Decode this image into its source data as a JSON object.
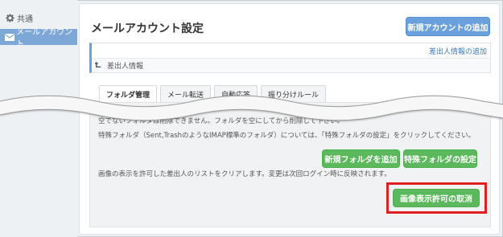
{
  "sidebar": {
    "items": [
      {
        "label": "共通",
        "icon": "gear-icon"
      },
      {
        "label": "メールアカウント",
        "icon": "envelope-icon",
        "active": true
      }
    ]
  },
  "main": {
    "title": "メールアカウント設定",
    "add_account_button": "新規アカウントの追加",
    "sender": {
      "add_link": "差出人情報の追加",
      "row_label": "差出人情報"
    },
    "tabs": [
      {
        "label": "フォルダ管理",
        "active": true
      },
      {
        "label": "メール転送"
      },
      {
        "label": "自動応答"
      },
      {
        "label": "振り分けルール"
      }
    ],
    "content": {
      "line1": "空でないフォルダは削除できません。フォルダを空にしてから削除して下さい。",
      "line2": "特殊フォルダ（Sent,TrashのようなIMAP標準のフォルダ）については、「特殊フォルダの設定」をクリックしてください。",
      "new_folder_button": "新規フォルダを追加",
      "special_folder_button": "特殊フォルダの設定",
      "line3": "画像の表示を許可した差出人のリストをクリアします。変更は次回ログイン時に反映されます。",
      "clear_button": "画像表示許可の取消"
    }
  },
  "colors": {
    "accent_blue": "#6aa0dc",
    "green": "#5cb85c",
    "highlight_red": "#e02020",
    "sidebar_active": "#7da7d6"
  }
}
